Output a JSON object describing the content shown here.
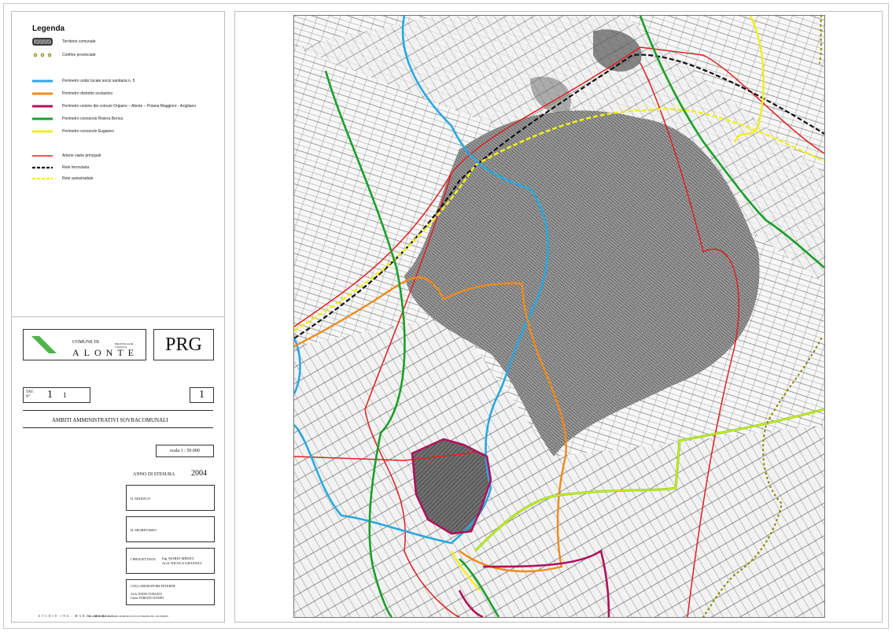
{
  "legend": {
    "title": "Legenda",
    "items": [
      {
        "label": "Territorio comunale",
        "symbol": "hatched-area",
        "color": "#555555"
      },
      {
        "label": "Confine provinciale",
        "symbol": "dotted-line",
        "color": "#8a8a00"
      },
      {
        "label": "Perimetro unita' locale socio sanitaria n. 5",
        "symbol": "line",
        "color": "#29a8e0"
      },
      {
        "label": "Perimetro distretto scolastico",
        "symbol": "line",
        "color": "#f08a1c"
      },
      {
        "label": "Perimetro unione dei comuni Orgiano – Alonte – Poiana Maggiore - Asigliano",
        "symbol": "line",
        "color": "#b0125b"
      },
      {
        "label": "Perimetro consorzio Riviera Berica",
        "symbol": "line",
        "color": "#1aa02a"
      },
      {
        "label": "Perimetro consorzio Euganeo",
        "symbol": "line",
        "color": "#f3ee1a"
      },
      {
        "label": "Arterie viarie principali",
        "symbol": "line",
        "color": "#e02020"
      },
      {
        "label": "Rete ferroviaria",
        "symbol": "dashed-line",
        "color": "#111111"
      },
      {
        "label": "Rete autostradale",
        "symbol": "dashed-line",
        "color": "#f3ee1a"
      }
    ]
  },
  "title_block": {
    "comune_prefix": "COMUNE DI",
    "provincia": "PROVINCIA DI VICENZA",
    "comune_name": "ALONTE",
    "plan_code": "PRG",
    "tav_label": "TAV. N°",
    "tav_number": "1",
    "tav_sub": "1",
    "sheet_number": "1",
    "subject": "AMBITI AMMINISTRATIVI SOVRACOMUNALI",
    "scala": "scala   1 : 50.000",
    "anno_label": "ANNO DI STESURA",
    "anno_value": "2004",
    "sindaco_label": "IL SINDACO",
    "segretario_label": "IL SEGRETARIO",
    "progettisti_label": "I PROGETTISTI:",
    "progettisti_names": [
      "Ing. MARIO MEDICI",
      "Arch. NICOLA GRAZIOLI"
    ],
    "collaboratori_label": "COLLABORATORI INTERNI:",
    "collaboratori_names": [
      "Arch. NADIA TURAZZA",
      "Geom. FABIANO ZANINI"
    ],
    "studio": "STUDIO ING. MARIO MEDICI",
    "address": "VIA MONSIGNOR GIACOMO LEOPOLDI 26     37132 VERONA     TEL. 045 8950070"
  },
  "colors": {
    "ulss": "#29a8e0",
    "scolastico": "#f08a1c",
    "unione": "#b0125b",
    "riviera": "#1aa02a",
    "euganeo": "#f3ee1a",
    "arterie": "#e02020",
    "ferrovia": "#111111",
    "provinciale": "#8a8a00"
  }
}
